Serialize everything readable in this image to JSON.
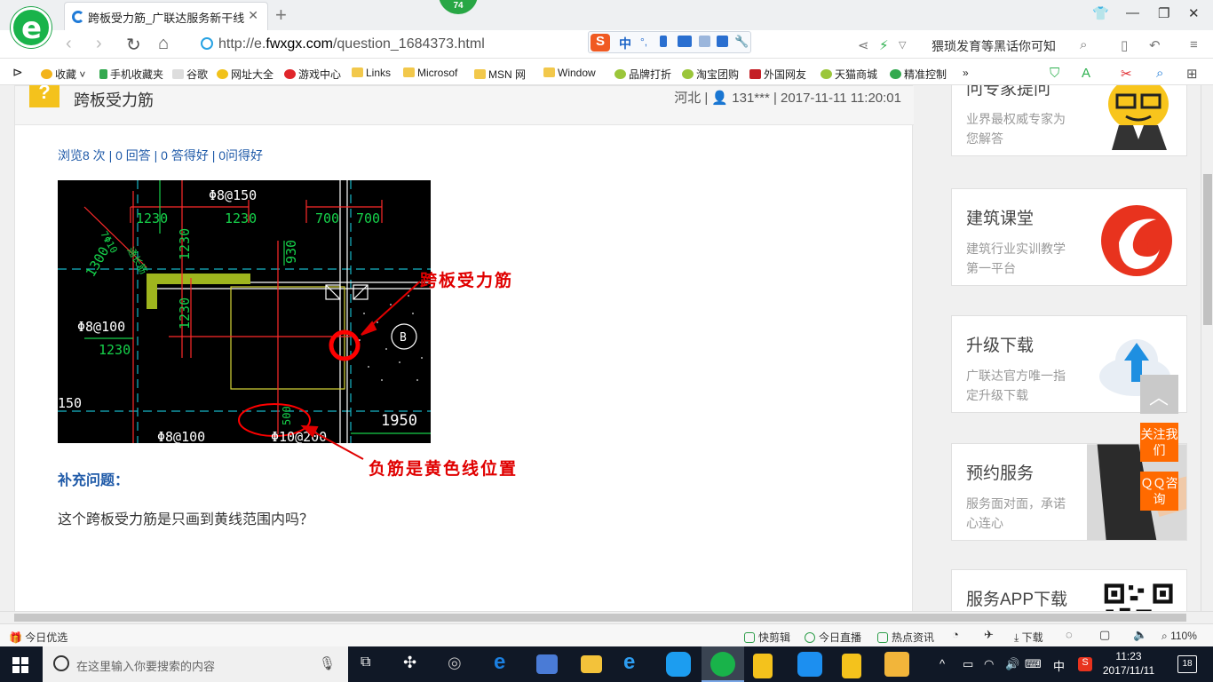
{
  "browser": {
    "tab_title": "跨板受力筋_广联达服务新干线",
    "badge_count": "74",
    "url_prefix": "http://e.",
    "url_domain": "fwxgx.com",
    "url_path": "/question_1684373.html",
    "ime_label": "中",
    "search_text": "猥琐发育等黑话你可知",
    "bookmarks": [
      "收藏",
      "手机收藏夹",
      "谷歌",
      "网址大全",
      "游戏中心",
      "Links",
      "Microsof",
      "MSN 网",
      "Window",
      "品牌打折",
      "淘宝团购",
      "外国网友",
      "天猫商城",
      "精准控制"
    ]
  },
  "question": {
    "title": "跨板受力筋",
    "meta": "河北 | 👤 131*** | 2017-11-11 11:20:01",
    "stats": "浏览8 次 | 0 回答 | 0 答得好 | 0问得好",
    "figure_annotations": [
      "跨板受力筋",
      "负筋是黄色线位置"
    ],
    "supplement_label": "补充问题：",
    "supplement_text": "这个跨板受力筋是只画到黄线范围内吗？"
  },
  "cad": {
    "labels": [
      "Φ8@150",
      "1230",
      "1230",
      "700",
      "700",
      "1230",
      "930",
      "1300",
      "Φ8@100",
      "1230",
      "1230",
      "150",
      "1950",
      "Φ8@100",
      "Φ10@200",
      "500",
      "B",
      "7Φ10",
      "通长筋"
    ]
  },
  "sidebar": {
    "cards": [
      {
        "title": "问专家提问",
        "desc": "业界最权威专家为您解答"
      },
      {
        "title": "建筑课堂",
        "desc": "建筑行业实训教学第一平台"
      },
      {
        "title": "升级下载",
        "desc": "广联达官方唯一指定升级下载"
      },
      {
        "title": "预约服务",
        "desc": "服务面对面，承诺心连心"
      },
      {
        "title": "服务APP下载",
        "desc": ""
      }
    ],
    "float_follow": "关注我们",
    "float_qq": "ＱＱ咨询"
  },
  "statusbar": {
    "left": "今日优选",
    "items": [
      "快剪辑",
      "今日直播",
      "热点资讯",
      "下载"
    ],
    "zoom": "110%"
  },
  "taskbar": {
    "search_placeholder": "在这里输入你要搜索的内容",
    "ime": "中",
    "time": "11:23",
    "date": "2017/11/11",
    "notifications": "18"
  },
  "colors": {
    "accent_blue": "#1f5aa8",
    "annotation_red": "#e00000",
    "float_orange": "#ff6a00",
    "browser_green": "#19b34a"
  }
}
